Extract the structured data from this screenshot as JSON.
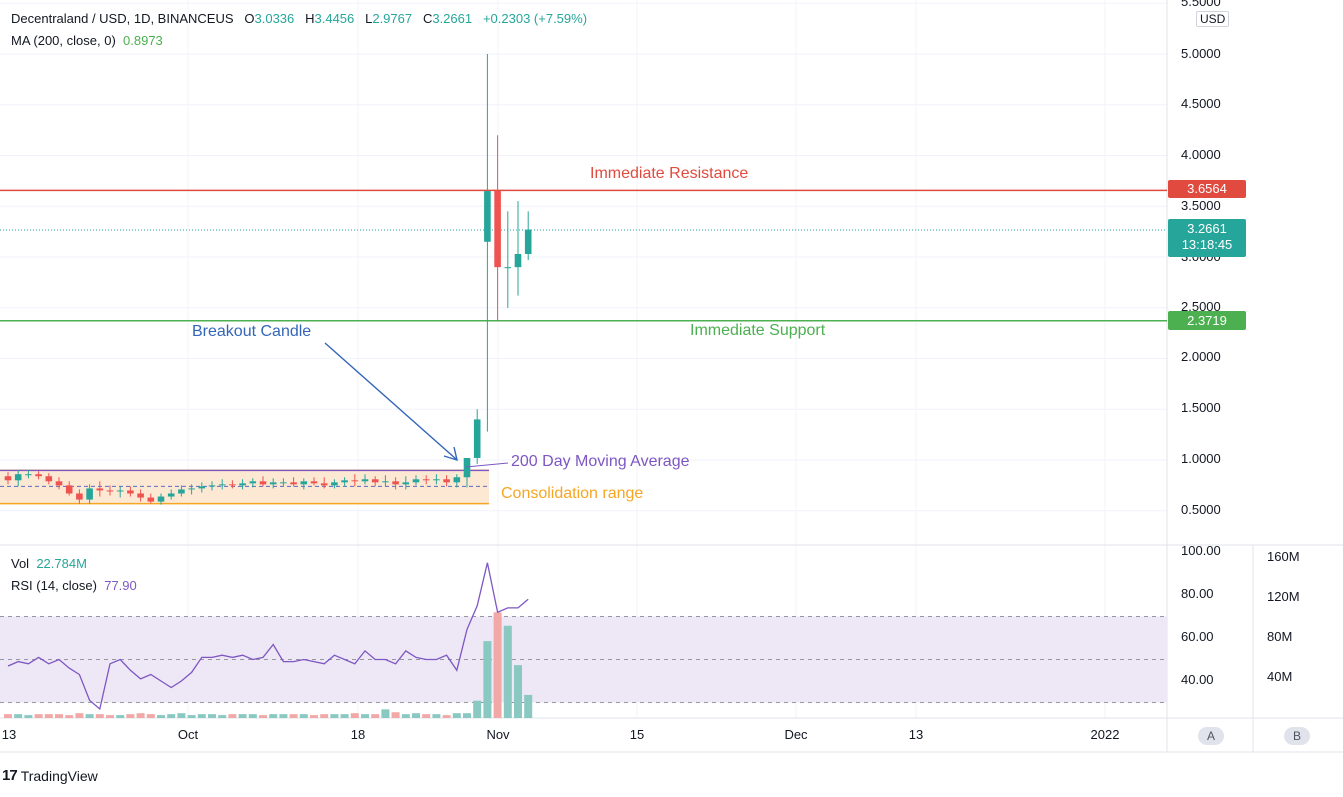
{
  "header": {
    "symbol": "Decentraland / USD, 1D, BINANCEUS",
    "o_label": "O",
    "o": "3.0336",
    "h_label": "H",
    "h": "3.4456",
    "l_label": "L",
    "l": "2.9767",
    "c_label": "C",
    "c": "3.2661",
    "change": "+0.2303 (+7.59%)",
    "ma_label": "MA (200, close, 0)",
    "ma_value": "0.8973",
    "vol_label": "Vol",
    "vol_value": "22.784M",
    "rsi_label": "RSI (14, close)",
    "rsi_value": "77.90"
  },
  "price_axis": {
    "currency": "USD",
    "ticks": [
      "5.5000",
      "5.0000",
      "4.5000",
      "4.0000",
      "3.5000",
      "3.0000",
      "2.5000",
      "2.0000",
      "1.5000",
      "1.0000",
      "0.5000"
    ],
    "resistance_label": "3.6564",
    "current_price": "3.2661",
    "countdown": "13:18:45",
    "support_label": "2.3719"
  },
  "rsi_axis": {
    "ticks": [
      "100.00",
      "80.00",
      "60.00",
      "40.00"
    ]
  },
  "volume_axis": {
    "ticks": [
      "160M",
      "120M",
      "80M",
      "40M"
    ]
  },
  "time_axis": {
    "labels": [
      "13",
      "Oct",
      "18",
      "Nov",
      "15",
      "Dec",
      "13",
      "2022"
    ]
  },
  "annotations": {
    "resistance": "Immediate Resistance",
    "support": "Immediate Support",
    "breakout": "Breakout Candle",
    "ma": "200 Day Moving Average",
    "consolidation": "Consolidation range"
  },
  "scale_buttons": {
    "a": "A",
    "b": "B"
  },
  "brand": {
    "logo": "17",
    "name": "TradingView"
  },
  "colors": {
    "up": "#26a69a",
    "down": "#ef5350",
    "resistance": "#e04a3f",
    "support": "#4caf50",
    "ma": "#7e57c2",
    "consolidation": "#f5a623",
    "breakout": "#3466b8",
    "rsi_line": "#7e57c2",
    "rsi_band": "#ede7f6"
  },
  "chart_data": {
    "type": "candlestick",
    "x": [
      "Sep 13",
      "Sep 14",
      "Sep 15",
      "Sep 16",
      "Sep 17",
      "Sep 18",
      "Sep 19",
      "Sep 20",
      "Sep 21",
      "Sep 22",
      "Sep 23",
      "Sep 24",
      "Sep 25",
      "Sep 26",
      "Sep 27",
      "Sep 28",
      "Sep 29",
      "Sep 30",
      "Oct 1",
      "Oct 2",
      "Oct 3",
      "Oct 4",
      "Oct 5",
      "Oct 6",
      "Oct 7",
      "Oct 8",
      "Oct 9",
      "Oct 10",
      "Oct 11",
      "Oct 12",
      "Oct 13",
      "Oct 14",
      "Oct 15",
      "Oct 16",
      "Oct 17",
      "Oct 18",
      "Oct 19",
      "Oct 20",
      "Oct 21",
      "Oct 22",
      "Oct 23",
      "Oct 24",
      "Oct 25",
      "Oct 26",
      "Oct 27",
      "Oct 28",
      "Oct 29",
      "Oct 30",
      "Oct 31",
      "Nov 1",
      "Nov 2",
      "Nov 3"
    ],
    "open": [
      0.84,
      0.8,
      0.86,
      0.86,
      0.84,
      0.79,
      0.75,
      0.67,
      0.61,
      0.72,
      0.7,
      0.69,
      0.7,
      0.67,
      0.63,
      0.59,
      0.64,
      0.67,
      0.71,
      0.72,
      0.74,
      0.75,
      0.76,
      0.75,
      0.77,
      0.79,
      0.76,
      0.78,
      0.78,
      0.76,
      0.79,
      0.77,
      0.75,
      0.78,
      0.8,
      0.79,
      0.81,
      0.78,
      0.79,
      0.76,
      0.78,
      0.81,
      0.8,
      0.81,
      0.78,
      0.83,
      1.02,
      3.15,
      3.65,
      2.9,
      2.9,
      3.03
    ],
    "high": [
      0.88,
      0.9,
      0.9,
      0.89,
      0.87,
      0.83,
      0.79,
      0.71,
      0.76,
      0.79,
      0.75,
      0.74,
      0.74,
      0.71,
      0.67,
      0.67,
      0.71,
      0.75,
      0.76,
      0.78,
      0.79,
      0.81,
      0.8,
      0.81,
      0.82,
      0.84,
      0.82,
      0.82,
      0.83,
      0.82,
      0.83,
      0.83,
      0.81,
      0.83,
      0.86,
      0.86,
      0.84,
      0.85,
      0.83,
      0.84,
      0.85,
      0.85,
      0.86,
      0.85,
      0.86,
      1.02,
      1.5,
      5.0,
      4.2,
      3.45,
      3.55,
      3.45
    ],
    "low": [
      0.76,
      0.74,
      0.82,
      0.81,
      0.76,
      0.71,
      0.65,
      0.57,
      0.57,
      0.64,
      0.65,
      0.63,
      0.64,
      0.59,
      0.57,
      0.56,
      0.61,
      0.64,
      0.66,
      0.68,
      0.7,
      0.71,
      0.72,
      0.71,
      0.73,
      0.74,
      0.72,
      0.74,
      0.74,
      0.71,
      0.75,
      0.72,
      0.72,
      0.74,
      0.74,
      0.76,
      0.74,
      0.74,
      0.71,
      0.71,
      0.75,
      0.76,
      0.76,
      0.74,
      0.73,
      0.73,
      0.96,
      1.28,
      2.37,
      2.5,
      2.62,
      2.97
    ],
    "close": [
      0.8,
      0.86,
      0.86,
      0.84,
      0.79,
      0.75,
      0.67,
      0.61,
      0.72,
      0.7,
      0.69,
      0.7,
      0.67,
      0.63,
      0.59,
      0.64,
      0.67,
      0.71,
      0.72,
      0.74,
      0.75,
      0.76,
      0.75,
      0.77,
      0.79,
      0.76,
      0.78,
      0.78,
      0.76,
      0.79,
      0.77,
      0.75,
      0.78,
      0.8,
      0.79,
      0.81,
      0.78,
      0.79,
      0.76,
      0.78,
      0.81,
      0.8,
      0.81,
      0.78,
      0.83,
      1.02,
      1.4,
      3.65,
      2.9,
      2.9,
      3.03,
      3.27
    ],
    "ma_200": 0.8973,
    "resistance": 3.6564,
    "support": 2.3719,
    "consolidation_range": [
      0.57,
      0.9
    ],
    "volume_millions": [
      4,
      4,
      3,
      4,
      4,
      4,
      3,
      5,
      4,
      4,
      3,
      3,
      4,
      5,
      4,
      3,
      4,
      5,
      3,
      4,
      4,
      3,
      4,
      4,
      4,
      3,
      4,
      4,
      4,
      4,
      3,
      4,
      4,
      4,
      5,
      4,
      4,
      9,
      6,
      4,
      5,
      4,
      4,
      3,
      5,
      5,
      18,
      80,
      110,
      96,
      55,
      24
    ],
    "rsi": [
      47,
      49,
      48,
      51,
      48,
      50,
      46,
      43,
      31,
      27,
      48,
      50,
      45,
      41,
      43,
      40,
      37,
      40,
      44,
      51,
      51,
      52,
      51,
      52,
      50,
      51,
      57,
      49,
      49,
      50,
      49,
      48,
      52,
      50,
      48,
      54,
      50,
      50,
      48,
      54,
      51,
      50,
      50,
      52,
      45,
      64,
      75,
      95,
      72,
      74,
      74,
      78
    ],
    "y_range_price": [
      0.3,
      5.6
    ],
    "rsi_range": [
      20,
      100
    ],
    "volume_axis_max_millions": 180
  }
}
